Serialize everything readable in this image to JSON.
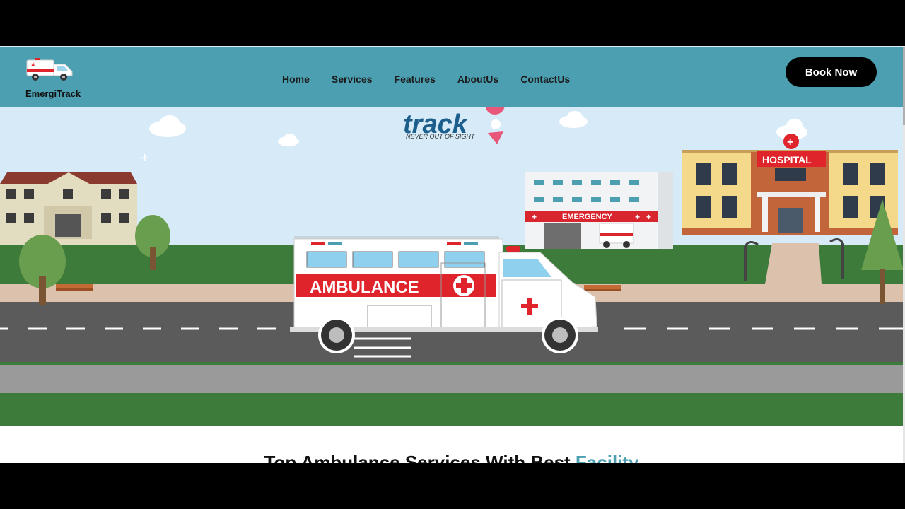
{
  "brand": {
    "name": "EmergiTrack",
    "logo_icon": "ambulance-icon"
  },
  "nav": {
    "items": [
      "Home",
      "Services",
      "Features",
      "AboutUs",
      "ContactUs"
    ]
  },
  "cta": {
    "label": "Book Now"
  },
  "hero": {
    "logo_text": "track",
    "logo_tagline": "NEVER OUT OF SIGHT",
    "ambulance_label": "AMBULANCE",
    "emergency_label": "EMERGENCY",
    "hospital_label": "HOSPITAL"
  },
  "section": {
    "heading_main": "Top Ambulance Services With Best ",
    "heading_accent": "Facility"
  },
  "colors": {
    "header": "#4b9fb0",
    "accent": "#4b9fb0",
    "button": "#000000",
    "red": "#e0242b"
  }
}
